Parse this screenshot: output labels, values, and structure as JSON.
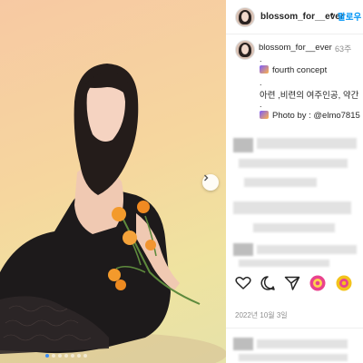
{
  "post": {
    "username": "blossom_for__ever",
    "separator": "•",
    "follow_label": "팔로우",
    "caption_age": "63주",
    "caption_lines": [
      ".",
      "fourth concept",
      ".",
      "아련 ,비련의 여주인공, 약간",
      ".",
      "Photo by : @elmo7815"
    ],
    "date": "2022년 10월 3일"
  },
  "carousel": {
    "slide_count": 7,
    "active_index": 0
  },
  "colors": {
    "accent": "#0095f6",
    "dot_active": "#3b8df6",
    "text": "#262626",
    "muted": "#8e8e8e"
  },
  "icons": {
    "like": "heart-icon",
    "comment": "comment-icon",
    "share": "paper-plane-icon",
    "extension_1": "pink-circle-extension-icon",
    "extension_2": "yellow-circle-extension-icon",
    "next": "chevron-right-icon"
  }
}
